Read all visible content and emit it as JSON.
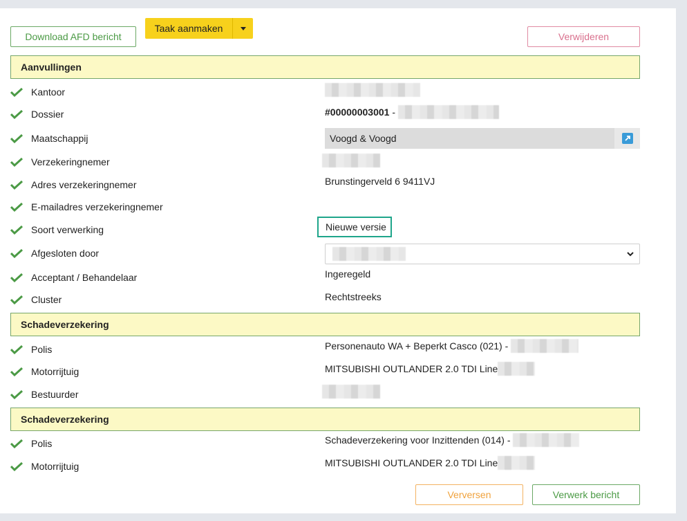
{
  "toolbar": {
    "download_label": "Download AFD bericht",
    "task_label": "Taak aanmaken",
    "delete_label": "Verwijderen"
  },
  "sections": {
    "aanvullingen": "Aanvullingen",
    "schade1": "Schadeverzekering",
    "schade2": "Schadeverzekering"
  },
  "rows": {
    "kantoor": "Kantoor",
    "dossier": "Dossier",
    "maatschappij": "Maatschappij",
    "verzekeringnemer": "Verzekeringnemer",
    "adres": "Adres verzekeringnemer",
    "email": "E-mailadres verzekeringnemer",
    "soort": "Soort verwerking",
    "afgesloten": "Afgesloten door",
    "acceptant": "Acceptant / Behandelaar",
    "cluster": "Cluster",
    "polis1": "Polis",
    "motor1": "Motorrijtuig",
    "bestuurder": "Bestuurder",
    "polis2": "Polis",
    "motor2": "Motorrijtuig"
  },
  "values": {
    "dossier_number": "#00000003001",
    "dossier_sep": " - ",
    "maatschappij": "Voogd & Voogd",
    "adres": "Brunstingerveld 6 9411VJ",
    "soort": "Nieuwe versie",
    "acceptant": "Ingeregeld",
    "cluster": "Rechtstreeks",
    "polis1": "Personenauto WA + Beperkt Casco (021) - ",
    "motor1": "MITSUBISHI OUTLANDER 2.0 TDI Line",
    "polis2": "Schadeverzekering voor Inzittenden (014) - ",
    "motor2": "MITSUBISHI OUTLANDER 2.0 TDI Line"
  },
  "footer": {
    "refresh_label": "Verversen",
    "process_label": "Verwerk bericht"
  },
  "colors": {
    "accent_green": "#4b9a45",
    "section_bg": "#fcf9c5",
    "primary_yellow": "#f7d11c",
    "highlight_teal": "#1ea58a"
  },
  "icons": {
    "check": "check-icon",
    "external": "external-link-icon",
    "caret": "caret-down-icon"
  }
}
